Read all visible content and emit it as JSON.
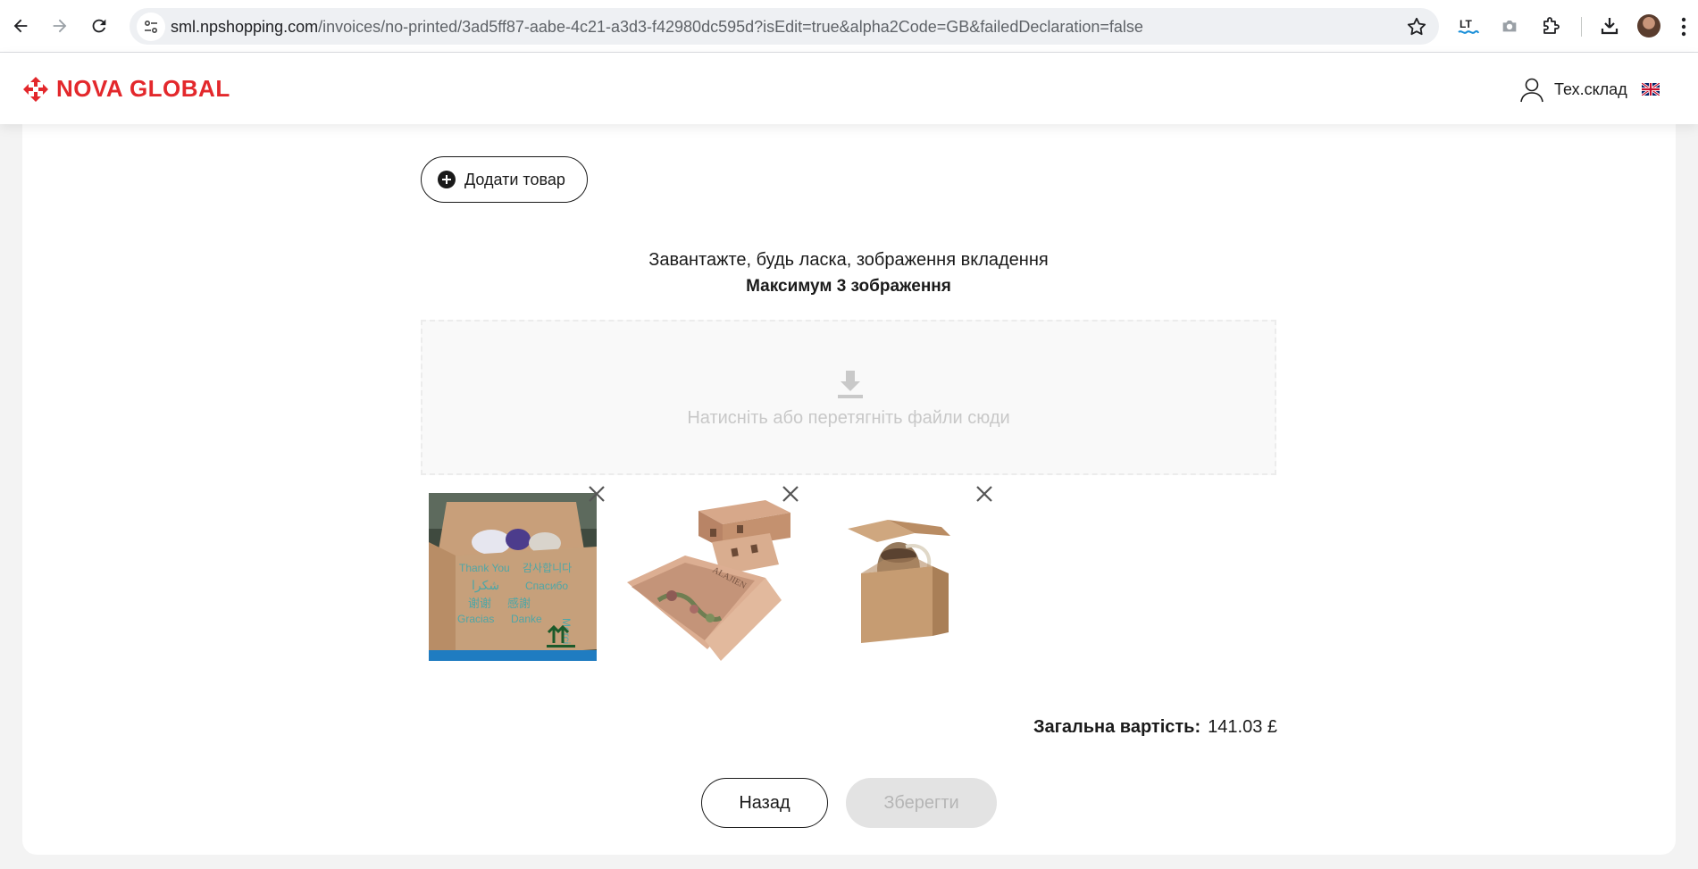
{
  "browser": {
    "url_domain": "sml.npshopping.com",
    "url_path": "/invoices/no-printed/3ad5ff87-aabe-4c21-a3d3-f42980dc595d?isEdit=true&alpha2Code=GB&failedDeclaration=false"
  },
  "header": {
    "logo_text": "NOVA GLOBAL",
    "user_name": "Тех.склад",
    "brand_color": "#e3282c"
  },
  "form": {
    "add_item_label": "Додати товар",
    "upload_title": "Завантажте, будь ласка, зображення вкладення",
    "upload_max": "Максимум 3 зображення",
    "dropzone_text": "Натисніть або перетягніть файли сюди",
    "images": [
      {
        "name": "thank-you-box-photo"
      },
      {
        "name": "long-gift-box-photo"
      },
      {
        "name": "small-kraft-box-photo"
      }
    ],
    "total_label": "Загальна вартість:",
    "total_value": "141.03 £",
    "back_label": "Назад",
    "save_label": "Зберегти"
  }
}
